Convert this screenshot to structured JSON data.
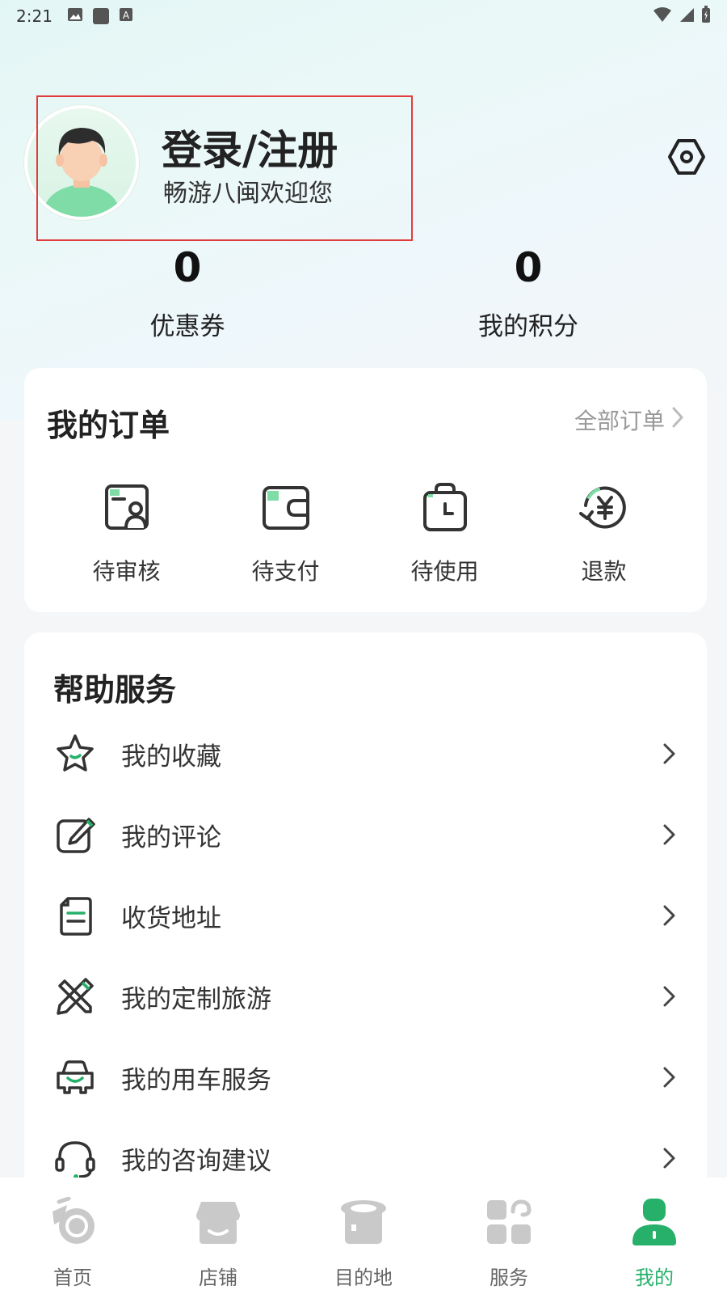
{
  "status_bar": {
    "time": "2:21",
    "notification_icons": [
      "image-icon",
      "app-icon",
      "a-icon"
    ],
    "right_icons": [
      "wifi-icon",
      "signal-icon",
      "battery-icon"
    ]
  },
  "profile": {
    "title": "登录/注册",
    "subtitle": "畅游八闽欢迎您"
  },
  "stats": [
    {
      "value": "0",
      "label": "优惠券"
    },
    {
      "value": "0",
      "label": "我的积分"
    }
  ],
  "orders": {
    "title": "我的订单",
    "all_label": "全部订单",
    "items": [
      {
        "label": "待审核",
        "icon": "review-icon"
      },
      {
        "label": "待支付",
        "icon": "wallet-icon"
      },
      {
        "label": "待使用",
        "icon": "ticket-clock-icon"
      },
      {
        "label": "退款",
        "icon": "refund-icon"
      }
    ]
  },
  "help": {
    "title": "帮助服务",
    "items": [
      {
        "label": "我的收藏",
        "icon": "star-icon"
      },
      {
        "label": "我的评论",
        "icon": "edit-icon"
      },
      {
        "label": "收货地址",
        "icon": "address-icon"
      },
      {
        "label": "我的定制旅游",
        "icon": "custom-tour-icon"
      },
      {
        "label": "我的用车服务",
        "icon": "car-icon"
      },
      {
        "label": "我的咨询建议",
        "icon": "headset-icon"
      }
    ]
  },
  "tabbar": {
    "items": [
      {
        "label": "首页",
        "icon": "home-icon",
        "active": false
      },
      {
        "label": "店铺",
        "icon": "shop-icon",
        "active": false
      },
      {
        "label": "目的地",
        "icon": "destination-icon",
        "active": false
      },
      {
        "label": "服务",
        "icon": "service-icon",
        "active": false
      },
      {
        "label": "我的",
        "icon": "profile-icon",
        "active": true
      }
    ]
  },
  "colors": {
    "accent": "#26b06a",
    "highlight_border": "#e03c3c"
  }
}
